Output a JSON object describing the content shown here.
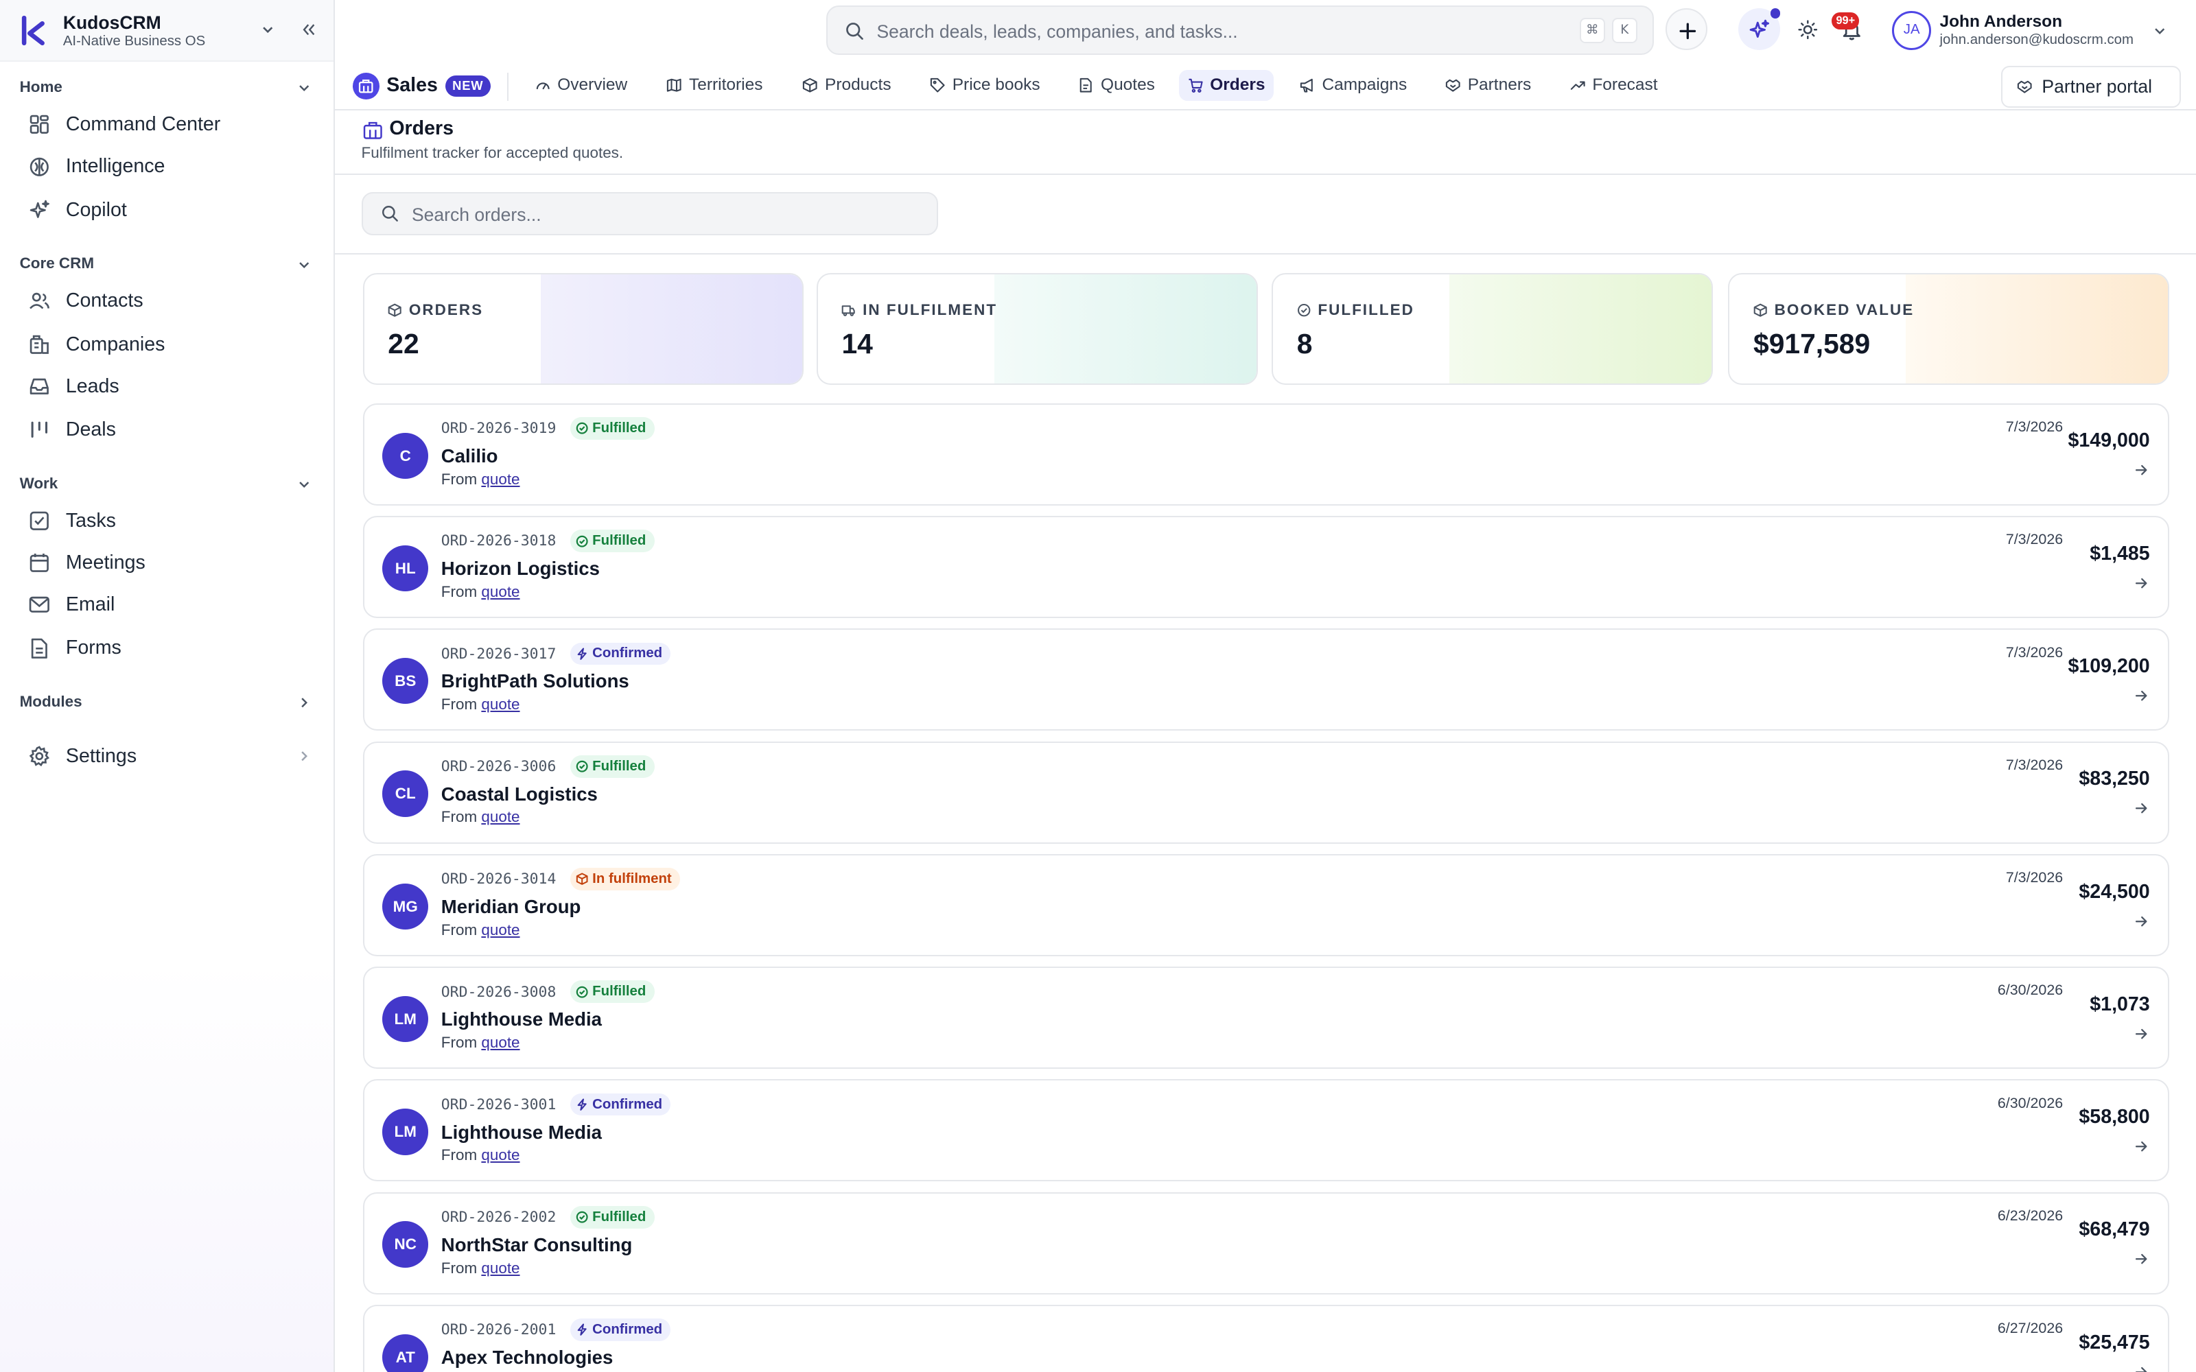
{
  "brand": {
    "name": "KudosCRM",
    "subtitle": "AI-Native Business OS"
  },
  "sidebar": {
    "sections": [
      {
        "title": "Home",
        "items": [
          {
            "label": "Command Center",
            "icon": "grid-icon"
          },
          {
            "label": "Intelligence",
            "icon": "brain-icon"
          },
          {
            "label": "Copilot",
            "icon": "sparkles-icon"
          }
        ]
      },
      {
        "title": "Core CRM",
        "items": [
          {
            "label": "Contacts",
            "icon": "users-icon"
          },
          {
            "label": "Companies",
            "icon": "building-icon"
          },
          {
            "label": "Leads",
            "icon": "inbox-icon"
          },
          {
            "label": "Deals",
            "icon": "kanban-icon"
          }
        ]
      },
      {
        "title": "Work",
        "items": [
          {
            "label": "Tasks",
            "icon": "checkbox-icon"
          },
          {
            "label": "Meetings",
            "icon": "calendar-icon"
          },
          {
            "label": "Email",
            "icon": "mail-icon"
          },
          {
            "label": "Forms",
            "icon": "file-icon"
          }
        ]
      }
    ],
    "modules_label": "Modules",
    "settings_label": "Settings"
  },
  "topbar": {
    "search_placeholder": "Search deals, leads, companies, and tasks...",
    "kbd1": "⌘",
    "kbd2": "K",
    "notification_count": "99+",
    "user": {
      "initials": "JA",
      "name": "John Anderson",
      "email": "john.anderson@kudoscrm.com"
    }
  },
  "module": {
    "name": "Sales",
    "badge": "NEW",
    "tabs": [
      {
        "label": "Overview",
        "icon": "gauge-icon"
      },
      {
        "label": "Territories",
        "icon": "map-icon"
      },
      {
        "label": "Products",
        "icon": "box-icon"
      },
      {
        "label": "Price books",
        "icon": "tag-icon"
      },
      {
        "label": "Quotes",
        "icon": "document-icon"
      },
      {
        "label": "Orders",
        "icon": "cart-icon",
        "active": true
      },
      {
        "label": "Campaigns",
        "icon": "megaphone-icon"
      },
      {
        "label": "Partners",
        "icon": "handshake-icon"
      },
      {
        "label": "Forecast",
        "icon": "trend-icon"
      }
    ],
    "partner_portal": "Partner portal"
  },
  "page": {
    "title": "Orders",
    "subtitle": "Fulfilment tracker for accepted quotes.",
    "search_placeholder": "Search orders..."
  },
  "kpis": [
    {
      "label": "ORDERS",
      "value": "22",
      "icon": "box-icon"
    },
    {
      "label": "IN FULFILMENT",
      "value": "14",
      "icon": "truck-icon"
    },
    {
      "label": "FULFILLED",
      "value": "8",
      "icon": "check-circle-icon"
    },
    {
      "label": "BOOKED VALUE",
      "value": "$917,589",
      "icon": "box-icon"
    }
  ],
  "orders": [
    {
      "initials": "C",
      "id": "ORD-2026-3019",
      "status": "Fulfilled",
      "company": "Calilio",
      "from_prefix": "From",
      "from_link": "quote",
      "date": "7/3/2026",
      "amount": "$149,000"
    },
    {
      "initials": "HL",
      "id": "ORD-2026-3018",
      "status": "Fulfilled",
      "company": "Horizon Logistics",
      "from_prefix": "From",
      "from_link": "quote",
      "date": "7/3/2026",
      "amount": "$1,485"
    },
    {
      "initials": "BS",
      "id": "ORD-2026-3017",
      "status": "Confirmed",
      "company": "BrightPath Solutions",
      "from_prefix": "From",
      "from_link": "quote",
      "date": "7/3/2026",
      "amount": "$109,200"
    },
    {
      "initials": "CL",
      "id": "ORD-2026-3006",
      "status": "Fulfilled",
      "company": "Coastal Logistics",
      "from_prefix": "From",
      "from_link": "quote",
      "date": "7/3/2026",
      "amount": "$83,250"
    },
    {
      "initials": "MG",
      "id": "ORD-2026-3014",
      "status": "In fulfilment",
      "company": "Meridian Group",
      "from_prefix": "From",
      "from_link": "quote",
      "date": "7/3/2026",
      "amount": "$24,500"
    },
    {
      "initials": "LM",
      "id": "ORD-2026-3008",
      "status": "Fulfilled",
      "company": "Lighthouse Media",
      "from_prefix": "From",
      "from_link": "quote",
      "date": "6/30/2026",
      "amount": "$1,073"
    },
    {
      "initials": "LM",
      "id": "ORD-2026-3001",
      "status": "Confirmed",
      "company": "Lighthouse Media",
      "from_prefix": "From",
      "from_link": "quote",
      "date": "6/30/2026",
      "amount": "$58,800"
    },
    {
      "initials": "NC",
      "id": "ORD-2026-2002",
      "status": "Fulfilled",
      "company": "NorthStar Consulting",
      "from_prefix": "From",
      "from_link": "quote",
      "date": "6/23/2026",
      "amount": "$68,479"
    },
    {
      "initials": "AT",
      "id": "ORD-2026-2001",
      "status": "Confirmed",
      "company": "Apex Technologies",
      "from_prefix": "From",
      "from_link": "quote",
      "date": "6/27/2026",
      "amount": "$25,475"
    }
  ]
}
